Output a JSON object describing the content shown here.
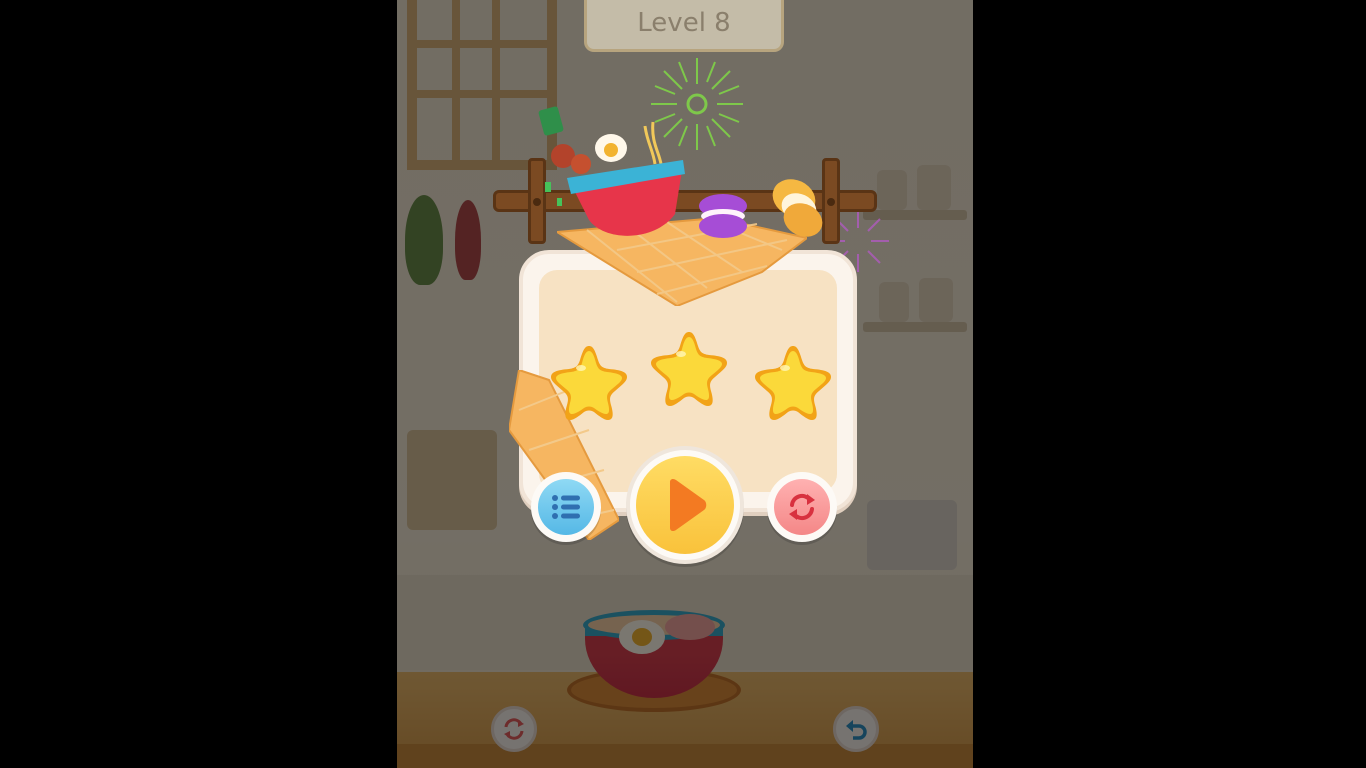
{
  "header": {
    "level_label": "Level 8"
  },
  "result": {
    "stars_earned": 3,
    "stars_total": 3
  },
  "buttons": {
    "menu_icon": "list-icon",
    "play_icon": "play-icon",
    "retry_icon": "refresh-icon",
    "bottom_restart_icon": "refresh-icon",
    "bottom_undo_icon": "undo-arrow-icon"
  },
  "colors": {
    "star": "#f8c823",
    "play_button": "#fbcf48",
    "menu_button": "#6cc6ee",
    "retry_button": "#f59a9a",
    "overlay": "rgba(0,0,0,0.52)"
  }
}
